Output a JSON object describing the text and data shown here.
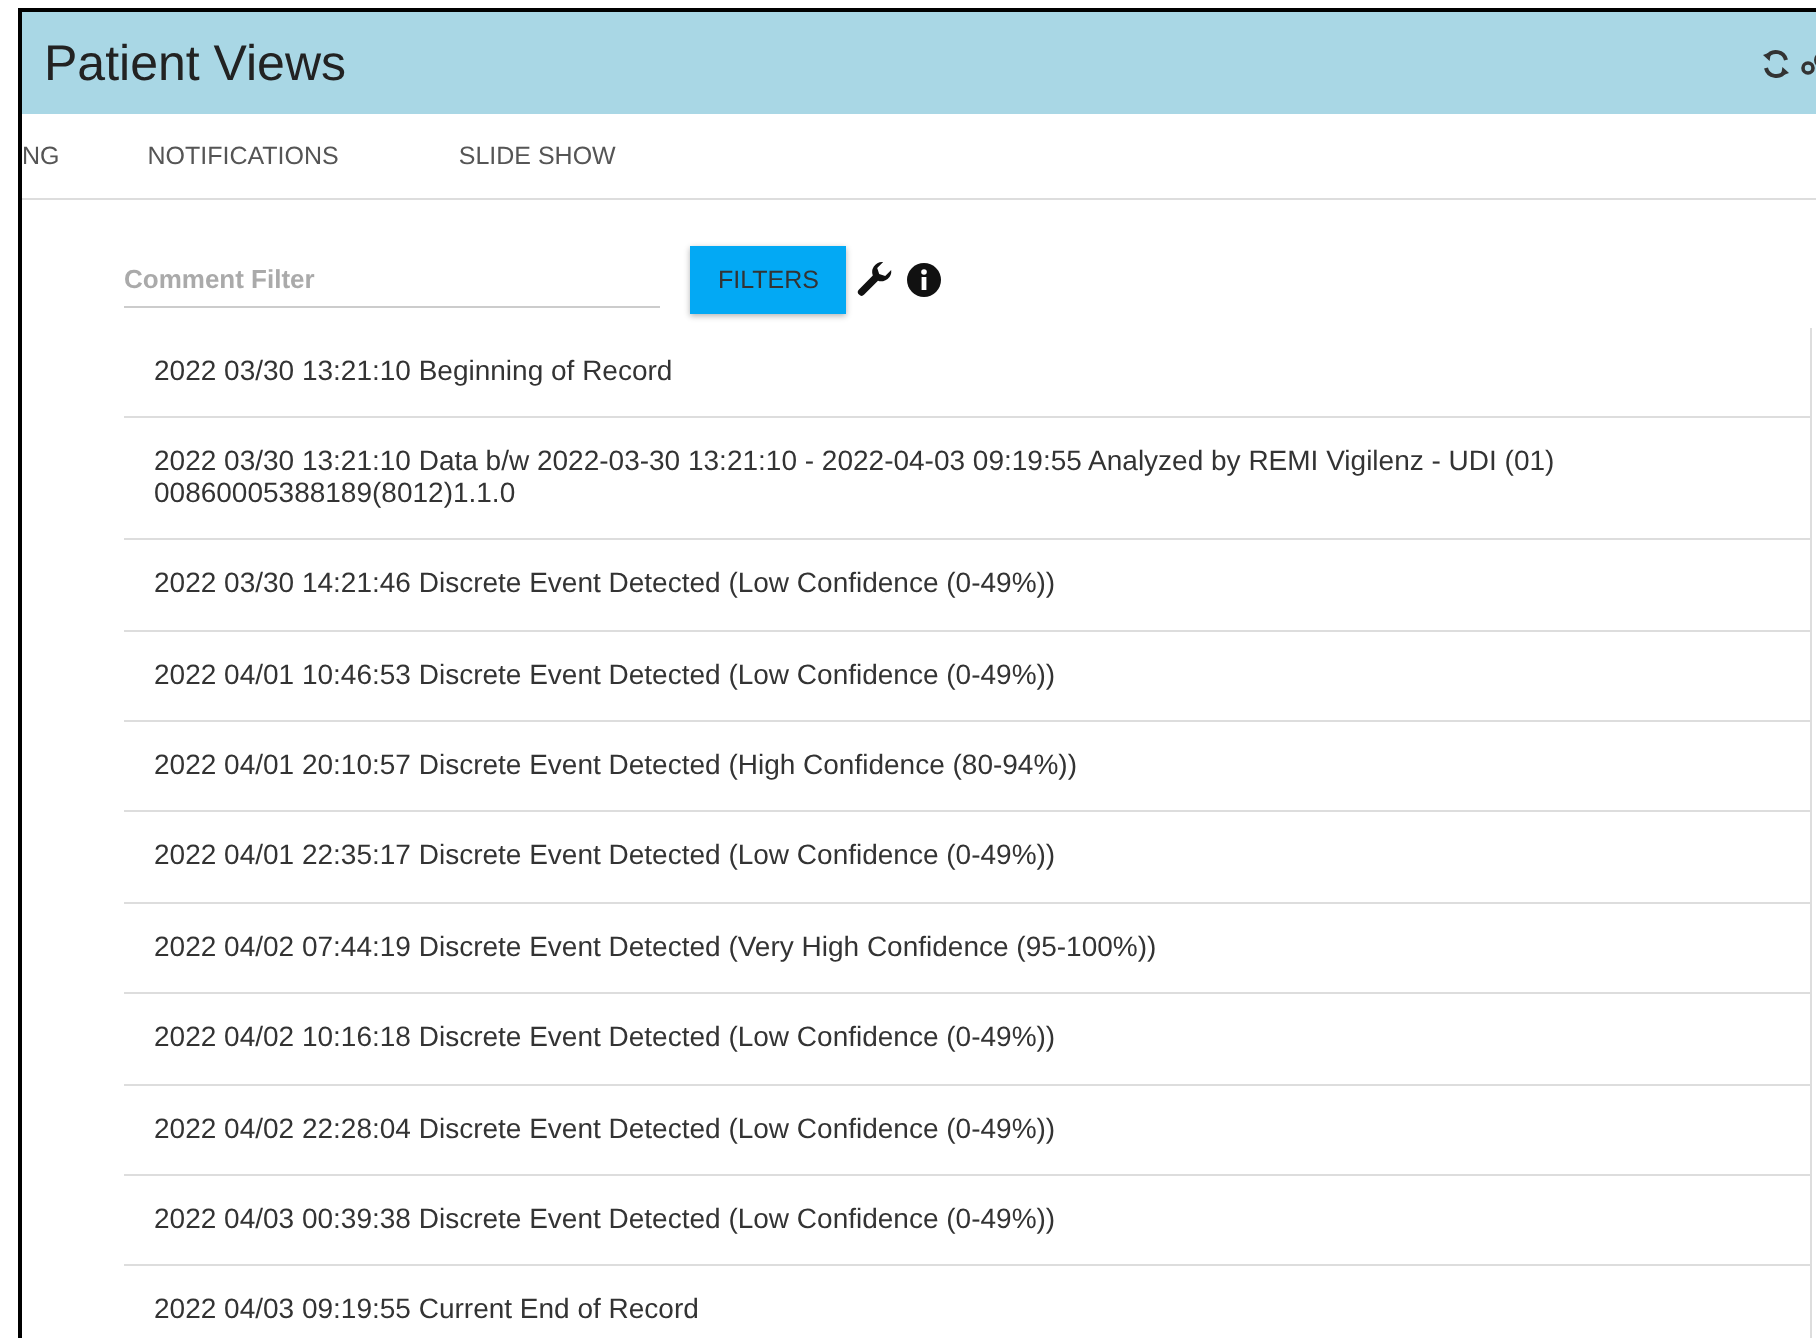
{
  "header": {
    "title": "Patient Views"
  },
  "tabs": [
    {
      "label": "NG"
    },
    {
      "label": "NOTIFICATIONS"
    },
    {
      "label": "SLIDE SHOW"
    }
  ],
  "filter": {
    "placeholder": "Comment Filter",
    "button": "FILTERS"
  },
  "comments": [
    {
      "text": "2022 03/30 13:21:10 Beginning of Record"
    },
    {
      "text": "2022 03/30 13:21:10 Data b/w 2022-03-30 13:21:10 - 2022-04-03 09:19:55 Analyzed by REMI Vigilenz - UDI (01) 00860005388189(8012)1.1.0"
    },
    {
      "text": "2022 03/30 14:21:46 Discrete Event Detected (Low Confidence (0-49%))"
    },
    {
      "text": "2022 04/01 10:46:53 Discrete Event Detected (Low Confidence (0-49%))"
    },
    {
      "text": "2022 04/01 20:10:57 Discrete Event Detected (High Confidence (80-94%))"
    },
    {
      "text": "2022 04/01 22:35:17 Discrete Event Detected (Low Confidence (0-49%))"
    },
    {
      "text": "2022 04/02 07:44:19 Discrete Event Detected (Very High Confidence (95-100%))"
    },
    {
      "text": "2022 04/02 10:16:18 Discrete Event Detected (Low Confidence (0-49%))"
    },
    {
      "text": "2022 04/02 22:28:04 Discrete Event Detected (Low Confidence (0-49%))"
    },
    {
      "text": "2022 04/03 00:39:38 Discrete Event Detected (Low Confidence (0-49%))"
    },
    {
      "text": "2022 04/03 09:19:55 Current End of Record"
    }
  ]
}
